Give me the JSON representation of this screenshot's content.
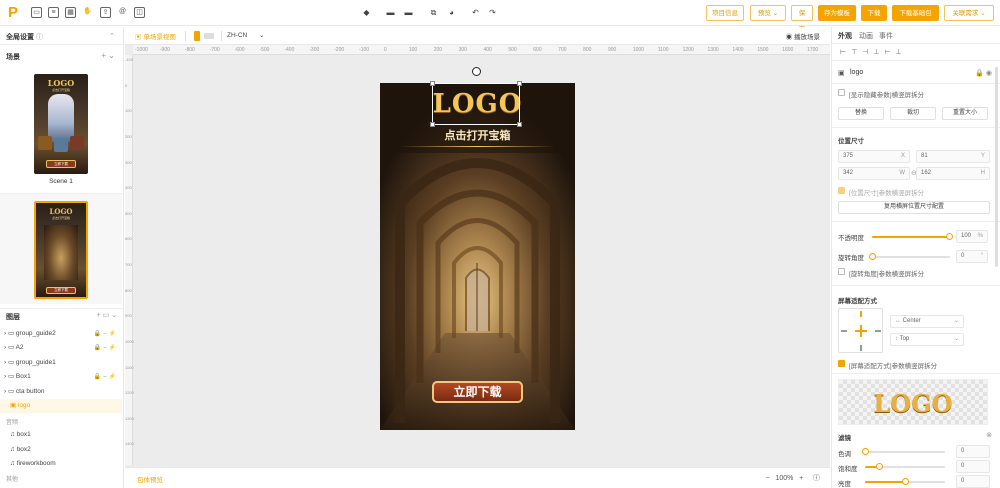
{
  "toolbar": {
    "logo_char": "P",
    "icons": [
      "document-icon",
      "layers-icon",
      "grid-icon",
      "image-icon",
      "hand-icon",
      "export-icon",
      "at-icon",
      "frame-icon"
    ],
    "center_icons": [
      "cube-icon",
      "shape-icon",
      "text-icon",
      "copy-icon",
      "paint-icon",
      "undo-icon",
      "redo-icon"
    ],
    "buttons": {
      "project_info": "项目信息",
      "preview": "预览",
      "save": "保存",
      "save_template": "存为模板",
      "download": "下载",
      "download_base": "下载基础包",
      "other": "关联需求"
    },
    "colors": {
      "accent": "#f5a300"
    }
  },
  "left": {
    "global_settings": "全局设置",
    "scenes_title": "场景",
    "scenes": [
      {
        "name": "Scene 1",
        "logo": "LOGO",
        "subtitle": "点击打开宝箱",
        "cta": "立即下载"
      },
      {
        "name": "",
        "logo": "LOGO",
        "subtitle": "点击打开宝箱",
        "cta": "立即下载"
      }
    ],
    "layers_title": "图层",
    "layers": [
      {
        "name": "group_guide2",
        "type": "folder",
        "icons": "🔒 👁 ⚡"
      },
      {
        "name": "A2",
        "type": "folder",
        "icons": "🔒 👁 ⚡"
      },
      {
        "name": "group_guide1",
        "type": "folder",
        "icons": ""
      },
      {
        "name": "Box1",
        "type": "folder",
        "icons": "🔒 👁 ⚡"
      },
      {
        "name": "cta button",
        "type": "folder",
        "icons": ""
      },
      {
        "name": "logo",
        "type": "image",
        "icons": ""
      }
    ],
    "audio_title": "音频",
    "audio": [
      "box1",
      "box2",
      "fireworkboom"
    ],
    "other_title": "其他"
  },
  "canvas": {
    "scene_tab": "单场景视图",
    "language": "ZH-CN",
    "play_label": "播放场景",
    "ruler_h": [
      "-1000",
      "-900",
      "-800",
      "-700",
      "-600",
      "-500",
      "-400",
      "-300",
      "-200",
      "-100",
      "0",
      "100",
      "200",
      "300",
      "400",
      "500",
      "600",
      "700",
      "800",
      "900",
      "1000",
      "1100",
      "1200",
      "1300",
      "1400",
      "1500",
      "1600",
      "1700"
    ],
    "ruler_v": [
      "-100",
      "0",
      "100",
      "200",
      "300",
      "400",
      "500",
      "600",
      "700",
      "800",
      "900",
      "1000",
      "1100",
      "1200",
      "1300",
      "1400"
    ],
    "bottom_left": "包体预览",
    "zoom": "100%",
    "phone": {
      "logo": "LOGO",
      "subtitle": "点击打开宝箱",
      "cta": "立即下载"
    }
  },
  "right": {
    "tabs": [
      "外观",
      "动画",
      "事件"
    ],
    "element_name": "logo",
    "show_hidden_params": "[显示隐藏参数]横竖屏拆分",
    "btn_replace": "替换",
    "btn_crop": "裁切",
    "btn_reset_size": "重置大小",
    "position_size_title": "位置尺寸",
    "x": "375",
    "y": "81",
    "w": "342",
    "h": "162",
    "x_label": "X",
    "y_label": "Y",
    "w_label": "W",
    "h_label": "H",
    "pos_split": "[位置尺寸]参数横竖屏拆分",
    "reuse_layout": "复用横屏位置尺寸配置",
    "opacity_label": "不透明度",
    "opacity_value": "100",
    "opacity_unit": "%",
    "opacity": 1.0,
    "rotation_label": "旋转角度",
    "rotation_value": "0",
    "rotation_unit": "°",
    "rotation_split": "[旋转角度]参数横竖屏拆分",
    "adapt_title": "屏幕适配方式",
    "adapt_h": "Center",
    "adapt_v": "Top",
    "adapt_split": "[屏幕适配方式]参数横竖屏拆分",
    "preview_logo": "LOGO",
    "filter_title": "滤镜",
    "hue_label": "色调",
    "hue_value": "0",
    "saturation_label": "饱和度",
    "saturation_value": "0",
    "brightness_label": "亮度",
    "brightness_value": "0"
  }
}
